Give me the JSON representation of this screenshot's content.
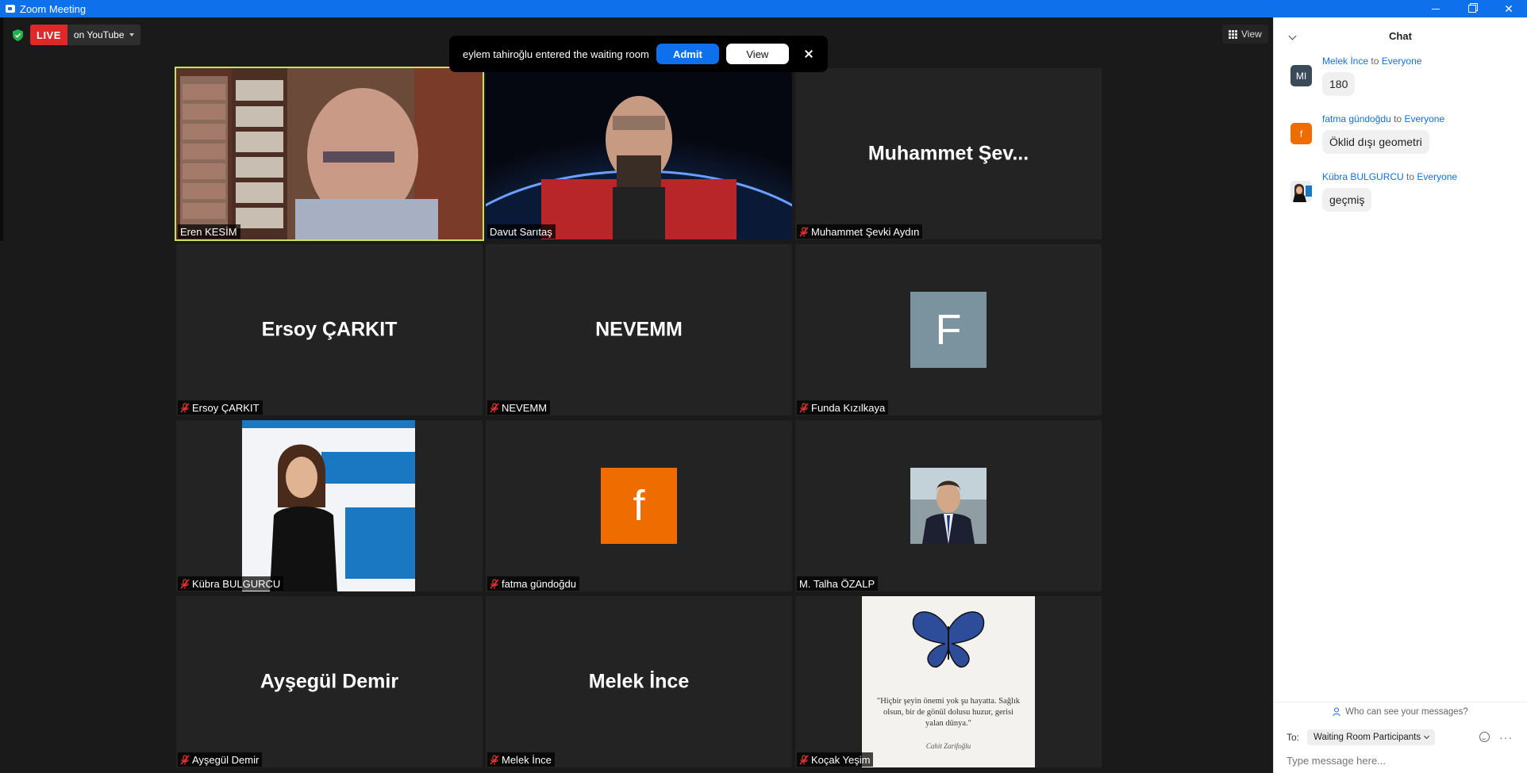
{
  "window": {
    "title": "Zoom Meeting"
  },
  "toolbar": {
    "live_label": "LIVE",
    "live_destination": "on YouTube",
    "view_label": "View"
  },
  "waiting_room": {
    "message": "eylem tahiroğlu entered the waiting room",
    "admit_label": "Admit",
    "view_label": "View"
  },
  "tiles": [
    {
      "name": "Eren KESİM",
      "muted": false,
      "type": "video",
      "active": true
    },
    {
      "name": "Davut Sarıtaş",
      "muted": false,
      "type": "video"
    },
    {
      "name": "Muhammet Şevki Aydın",
      "display": "Muhammet  Şev...",
      "muted": true,
      "type": "name"
    },
    {
      "name": "Ersoy ÇARKIT",
      "display": "Ersoy ÇARKIT",
      "muted": true,
      "type": "name"
    },
    {
      "name": "NEVEMM",
      "display": "NEVEMM",
      "muted": true,
      "type": "name"
    },
    {
      "name": "Funda Kızılkaya",
      "avatar_letter": "F",
      "avatar_color": "#7b939e",
      "muted": true,
      "type": "avatar"
    },
    {
      "name": "Kübra BULGURCU",
      "muted": true,
      "type": "photo"
    },
    {
      "name": "fatma gündoğdu",
      "avatar_letter": "f",
      "avatar_color": "#ef6c00",
      "muted": true,
      "type": "avatar"
    },
    {
      "name": "M. Talha ÖZALP",
      "muted": false,
      "type": "photo"
    },
    {
      "name": "Ayşegül Demir",
      "display": "Ayşegül Demir",
      "muted": true,
      "type": "name"
    },
    {
      "name": "Melek İnce",
      "display": "Melek İnce",
      "muted": true,
      "type": "name"
    },
    {
      "name": "Koçak Yeşim",
      "muted": true,
      "type": "photo",
      "quote": "\"Hiçbir şeyin önemi yok şu hayatta. Sağlık olsun, bir de gönül dolusu huzur, gerisi yalan dünya.\"",
      "signature": "Cahit Zarifoğlu"
    }
  ],
  "chat": {
    "title": "Chat",
    "messages": [
      {
        "from": "Melek İnce",
        "to_word": "to",
        "to": "Everyone",
        "text": "180",
        "avatar": "MI",
        "avatar_color": "#3b4a5a"
      },
      {
        "from": "fatma gündoğdu",
        "to_word": "to",
        "to": "Everyone",
        "text": "Öklid dışı geometri",
        "avatar": "f",
        "avatar_color": "#ef6c00"
      },
      {
        "from": "Kübra BULGURCU",
        "to_word": "to",
        "to": "Everyone",
        "text": "geçmiş",
        "avatar": "",
        "avatar_color": "#8fb6cf"
      }
    ],
    "who_can_see": "Who can see your messages?",
    "to_label": "To:",
    "recipient": "Waiting Room Participants",
    "input_placeholder": "Type message here..."
  },
  "colors": {
    "accent": "#0e71eb",
    "live": "#e02828",
    "active_speaker": "#c8e05c"
  }
}
